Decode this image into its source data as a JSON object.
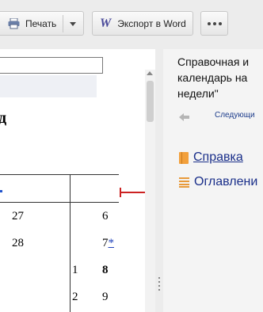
{
  "toolbar": {
    "print_label": "Печать",
    "word_icon_letter": "W",
    "word_label": "Экспорт в Word"
  },
  "document": {
    "heading_fragment": "д",
    "rows": [
      {
        "a": "27",
        "b": "6",
        "b_link": ""
      },
      {
        "a": "28",
        "b": "7",
        "b_link": "*"
      },
      {
        "c": "1",
        "d": "8"
      },
      {
        "c": "2",
        "d": "9"
      }
    ]
  },
  "panel": {
    "title_line1": "Справочная и",
    "title_line2": "календарь на",
    "title_line3": "недели\"",
    "next_label": "Следующи",
    "links": {
      "reference": "Справка",
      "contents": "Оглавлени"
    }
  },
  "colors": {
    "accent_red": "#cc2222",
    "link_blue": "#1a2f8a",
    "icon_orange": "#f2a03c"
  }
}
